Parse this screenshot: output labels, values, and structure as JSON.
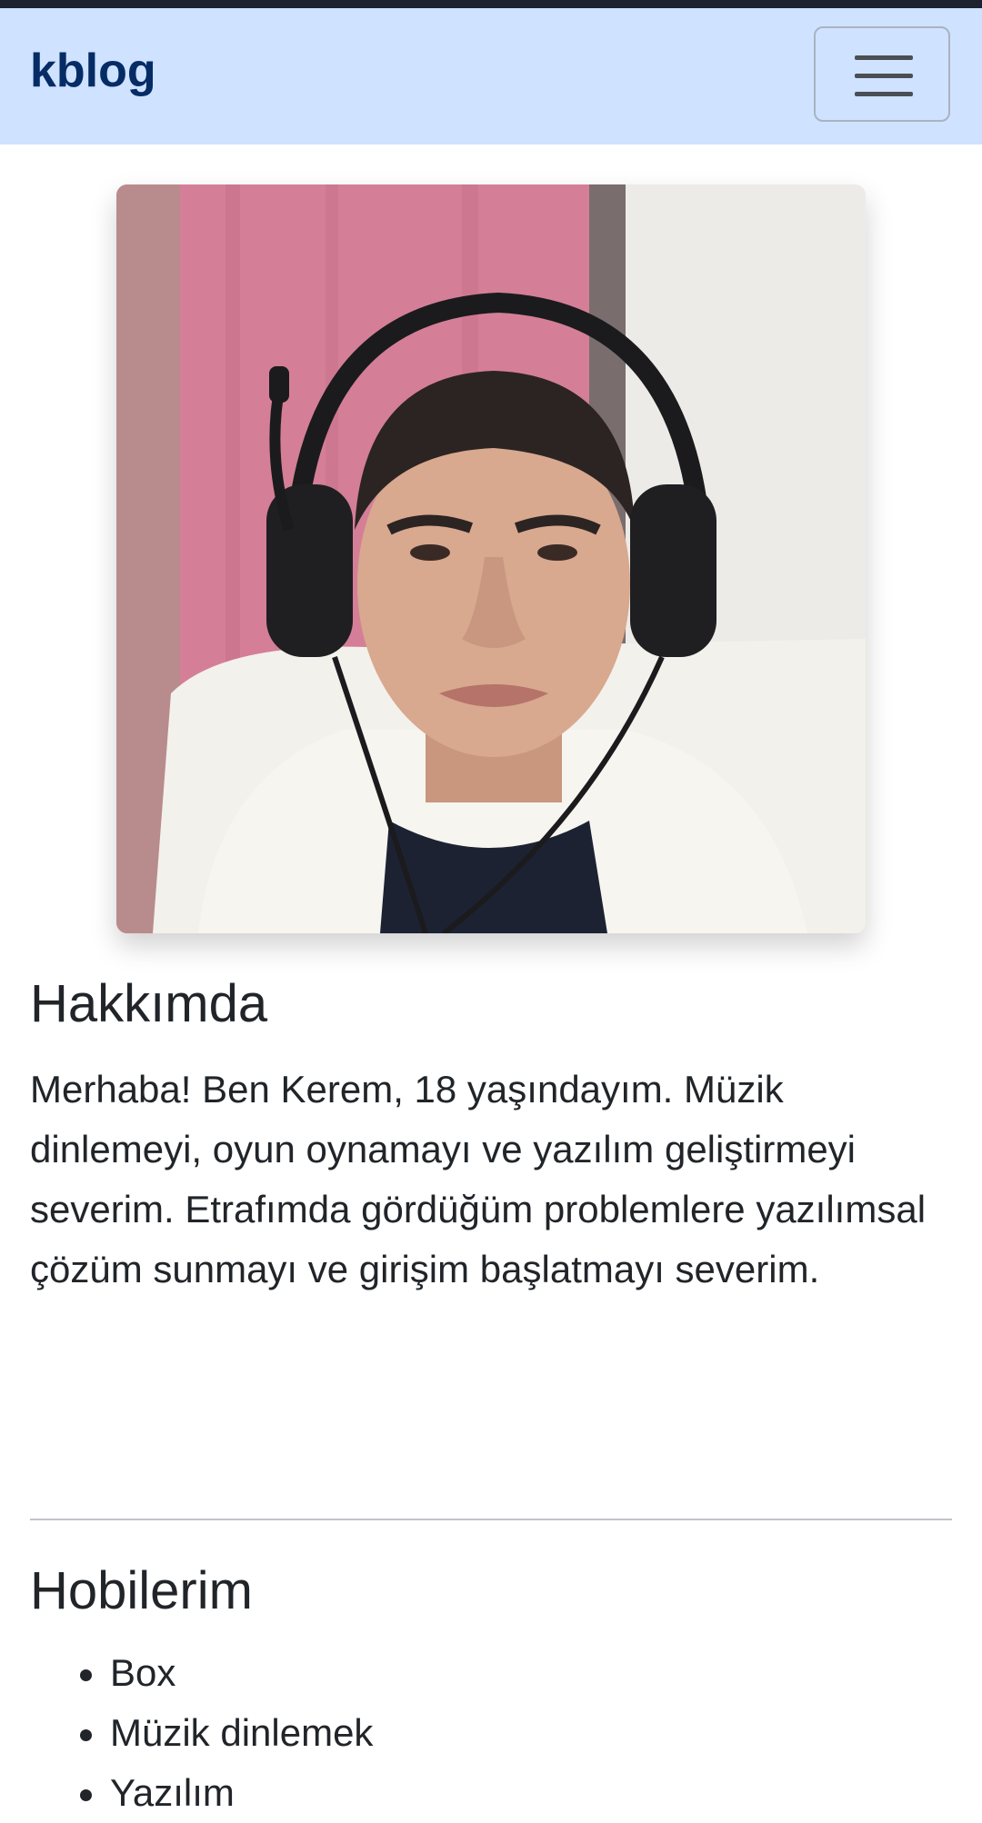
{
  "navbar": {
    "brand": "kblog",
    "menu_icon": "hamburger-menu-icon"
  },
  "profile": {
    "photo": "profile-photo"
  },
  "about": {
    "title": "Hakkımda",
    "text": "Merhaba! Ben Kerem, 18 yaşındayım. Müzik dinlemeyi, oyun oynamayı ve yazılım geliştirmeyi severim. Etrafımda gördüğüm problemlere yazılımsal çözüm sunmayı ve girişim başlatmayı severim."
  },
  "hobbies": {
    "title": "Hobilerim",
    "items": [
      "Box",
      "Müzik dinlemek",
      "Yazılım"
    ]
  },
  "colors": {
    "navbar_bg": "#cfe2ff",
    "brand": "#052c65",
    "text": "#212529"
  }
}
